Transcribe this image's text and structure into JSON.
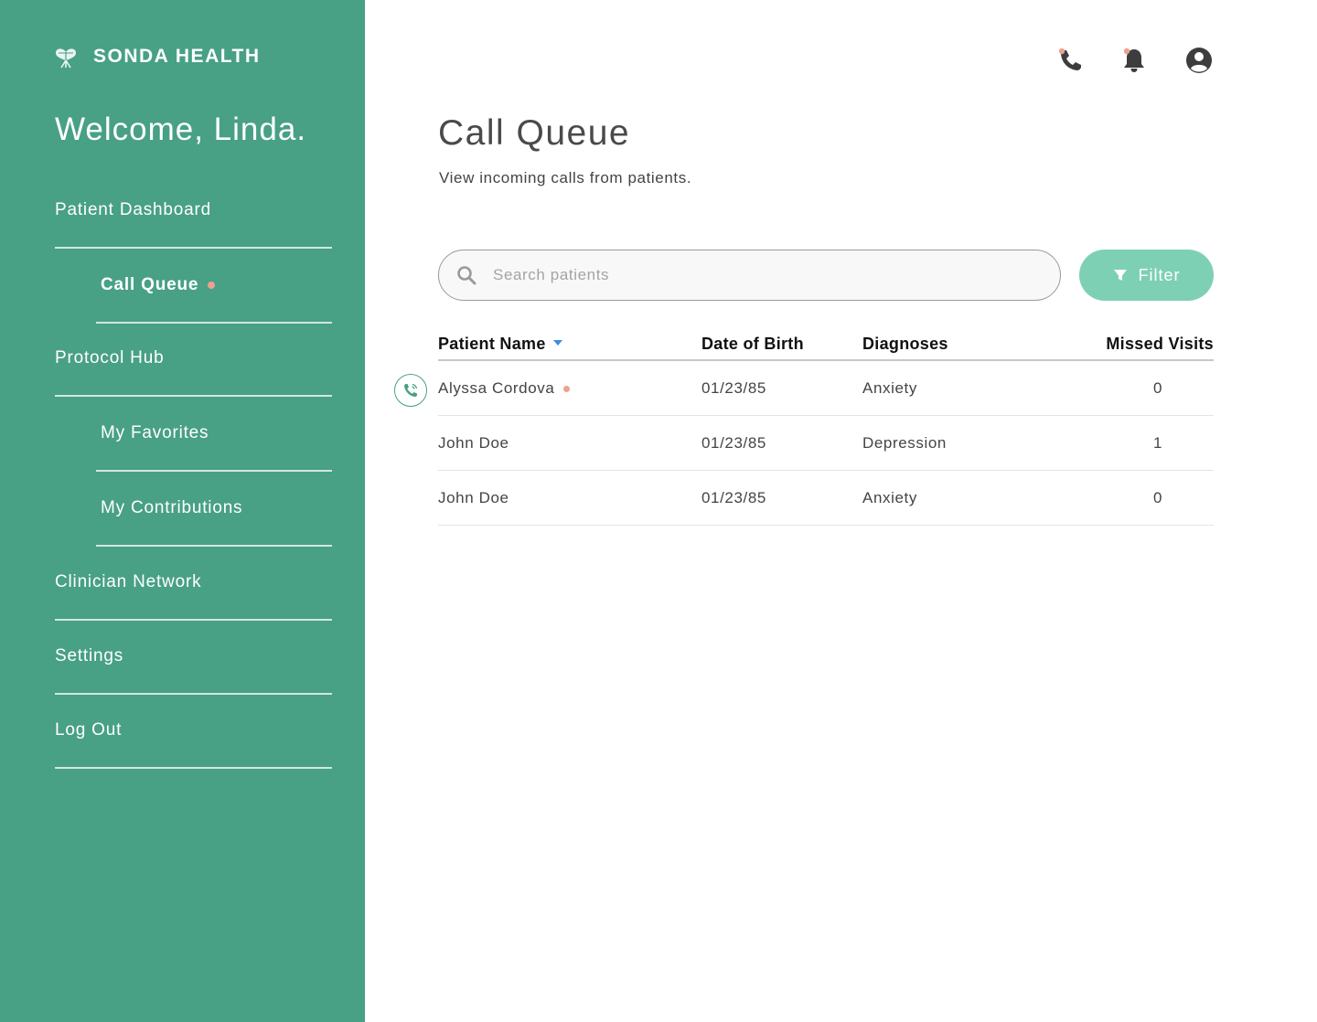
{
  "brand": {
    "name": "SONDA HEALTH",
    "logo_icon": "heart-logo-icon"
  },
  "sidebar": {
    "welcome": "Welcome, Linda.",
    "items": [
      {
        "label": "Patient Dashboard",
        "level": "top"
      },
      {
        "label": "Call Queue",
        "level": "sub",
        "active": true,
        "notification_dot": true
      },
      {
        "label": "Protocol Hub",
        "level": "top"
      },
      {
        "label": "My Favorites",
        "level": "sub"
      },
      {
        "label": "My Contributions",
        "level": "sub"
      },
      {
        "label": "Clinician Network",
        "level": "top"
      },
      {
        "label": "Settings",
        "level": "top"
      },
      {
        "label": "Log Out",
        "level": "top"
      }
    ]
  },
  "header": {
    "icons": [
      "phone-icon",
      "bell-icon",
      "account-icon"
    ],
    "phone_has_notification": true,
    "bell_has_notification": true
  },
  "main": {
    "title": "Call Queue",
    "subtitle": "View incoming calls from patients.",
    "search": {
      "placeholder": "Search patients",
      "value": ""
    },
    "filter_label": "Filter",
    "table": {
      "columns": [
        "Patient Name",
        "Date of Birth",
        "Diagnoses",
        "Missed Visits"
      ],
      "sorted_column": "Patient Name",
      "rows": [
        {
          "name": "Alyssa Cordova",
          "dob": "01/23/85",
          "diagnosis": "Anxiety",
          "missed": "0",
          "incoming_call": true
        },
        {
          "name": "John Doe",
          "dob": "01/23/85",
          "diagnosis": "Depression",
          "missed": "1",
          "incoming_call": false
        },
        {
          "name": "John Doe",
          "dob": "01/23/85",
          "diagnosis": "Anxiety",
          "missed": "0",
          "incoming_call": false
        }
      ]
    }
  },
  "colors": {
    "sidebar_bg": "#48a085",
    "accent": "#7ed0b5",
    "notification": "#f0a090",
    "sort_arrow": "#3a8fdc"
  }
}
